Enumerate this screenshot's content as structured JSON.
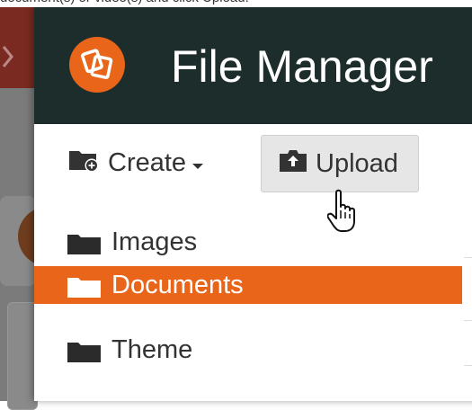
{
  "caption": "document(s) or video(s) and click Upload.",
  "header": {
    "title": "File Manager"
  },
  "toolbar": {
    "create_label": "Create",
    "upload_label": "Upload"
  },
  "folders": [
    {
      "label": "Images",
      "selected": false
    },
    {
      "label": "Documents",
      "selected": true
    },
    {
      "label": "Theme",
      "selected": false
    }
  ],
  "colors": {
    "accent": "#e8651a",
    "header_bg": "#1c2d2b",
    "button_bg": "#e6e6e6"
  },
  "icons": {
    "logo": "file-manager-logo-icon",
    "create": "folder-plus-icon",
    "upload": "upload-box-icon",
    "folder": "folder-icon",
    "cursor": "hand-pointer-icon"
  }
}
